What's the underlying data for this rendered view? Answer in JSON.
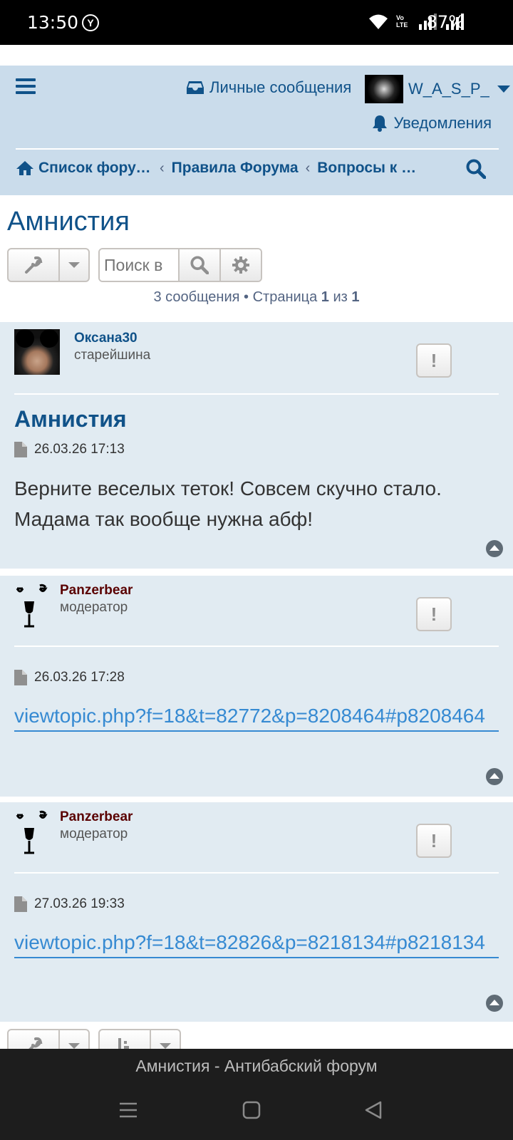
{
  "status_bar": {
    "time": "13:50",
    "battery": "87%",
    "volte": "Vo LTE"
  },
  "header": {
    "private_messages": "Личные сообщения",
    "username": "W_A_S_P_",
    "notifications": "Уведомления",
    "breadcrumbs": [
      "Список форум...",
      "Правила Форума",
      "Вопросы к ад..."
    ],
    "breadcrumb_sep": "‹"
  },
  "topic": {
    "title": "Амнистия",
    "search_placeholder": "Поиск в",
    "pageinfo_prefix": "3 сообщения • Страница ",
    "page_current": "1",
    "pageinfo_of": " из ",
    "page_total": "1"
  },
  "posts": [
    {
      "author": "Оксана30",
      "author_color": "#105289",
      "rank": "старейшина",
      "title": "Амнистия",
      "date": "26.03.26 17:13",
      "text": "Верните веселых теток! Совсем скучно стало. Мадама так вообще нужна абф!"
    },
    {
      "author": "Panzerbear",
      "author_color": "#5a0000",
      "rank": "модератор",
      "date": "26.03.26 17:28",
      "link": "viewtopic.php?f=18&t=82772&p=8208464#p8208464"
    },
    {
      "author": "Panzerbear",
      "author_color": "#5a0000",
      "rank": "модератор",
      "date": "27.03.26 19:33",
      "link": "viewtopic.php?f=18&t=82826&p=8218134#p8218134"
    }
  ],
  "report_label": "!",
  "browser": {
    "page_title": "Амнистия - Антибабский форум"
  },
  "colors": {
    "header_bg": "#cadceb",
    "post_bg": "#e1ebf2",
    "link": "#368ad2",
    "primary": "#105289"
  }
}
